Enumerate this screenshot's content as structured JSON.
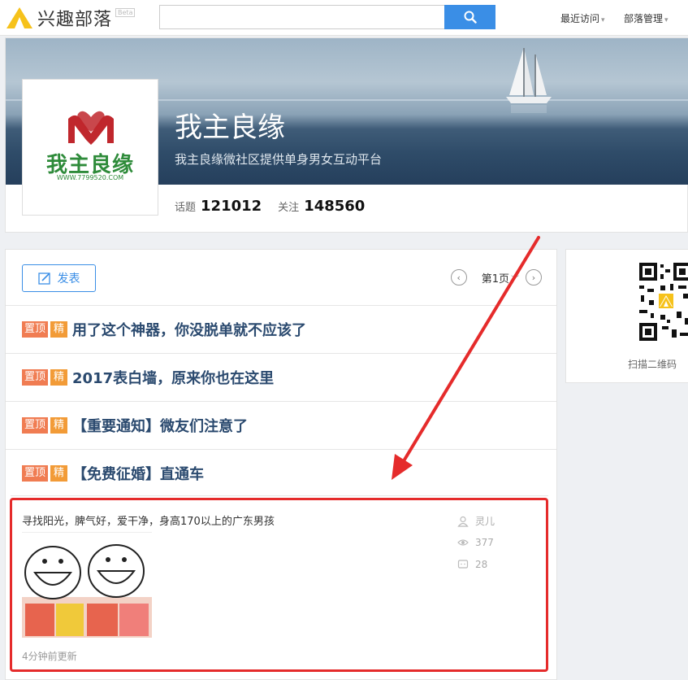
{
  "header": {
    "logo_text": "兴趣部落",
    "beta": "Beta",
    "search": {
      "value": "",
      "placeholder": ""
    },
    "nav": [
      "最近访问",
      "部落管理"
    ]
  },
  "tribe": {
    "name": "我主良缘",
    "description": "我主良缘微社区提供单身男女互动平台",
    "logo_text": "我主良缘",
    "logo_url_text": "WWW.7799520.COM",
    "stats": [
      {
        "label": "话题",
        "value": "121012"
      },
      {
        "label": "关注",
        "value": "148560"
      }
    ]
  },
  "toolbar": {
    "post_label": "发表",
    "page_label": "第1页"
  },
  "pinned_posts": [
    {
      "badge_top": "置顶",
      "badge_fine": "精",
      "title": "用了这个神器，你没脱单就不应该了"
    },
    {
      "badge_top": "置顶",
      "badge_fine": "精",
      "title": "2017表白墙，原来你也在这里"
    },
    {
      "badge_top": "置顶",
      "badge_fine": "精",
      "title": "【重要通知】微友们注意了"
    },
    {
      "badge_top": "置顶",
      "badge_fine": "精",
      "title": "【免费征婚】直通车"
    }
  ],
  "post": {
    "title": "寻找阳光，脾气好，爱干净，身高170以上的广东男孩",
    "author": "灵儿",
    "views": "377",
    "comments": "28",
    "time": "4分钟前更新"
  },
  "side": {
    "scan_text": "扫描二维码"
  },
  "colors": {
    "accent": "#3a8ee6",
    "badge_top": "#f07c52",
    "badge_fine": "#f29b37",
    "annotation": "#e52b2b"
  }
}
